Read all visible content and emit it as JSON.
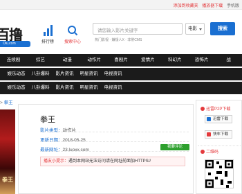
{
  "topbar": {
    "bookmark": "添加到收藏夹",
    "app": "播放器下载",
    "mobile": "手机版"
  },
  "header": {
    "logo_text": "百撸",
    "logo_sub": "Olu.com",
    "nav": [
      {
        "label": "排行榜",
        "icon": "bar-chart-icon"
      },
      {
        "label": "搜索中心",
        "icon": "search-center-icon"
      }
    ],
    "search": {
      "placeholder": "请您输入影片关键字",
      "select_value": "电影",
      "button": "搜索",
      "hot": "热门影视 · 嫌疑人X · 非常CMS"
    }
  },
  "nav_main": [
    "连续剧",
    "综艺",
    "动漫",
    "动作片",
    "喜剧片",
    "爱情片",
    "科幻片",
    "恐怖片",
    "战"
  ],
  "subnav1": [
    "娱乐动态",
    "八卦爆料",
    "影片资讯",
    "明星资讯",
    "电视资讯"
  ],
  "subnav2": [
    "娱乐动态",
    "八卦爆料",
    "影片资讯",
    "明星资讯",
    "电视资讯"
  ],
  "breadcrumb": {
    "sep": "> ",
    "current": "拳王"
  },
  "movie": {
    "poster_text": "拳王",
    "title": "拳王",
    "type_label": "影片类型：",
    "type_value": "动作片",
    "date_label": "更新日期：",
    "date_value": "2018-05-25",
    "site_label": "最新网址：",
    "site_value": "23.luoxx.com",
    "comment_button": "我要评论",
    "notice_label": "播友小提示：",
    "notice_text": "遇到本网站无法访问请在网址前面加HTTPS//"
  },
  "sidebar": {
    "p2p_title": "迅雷P2P下载",
    "buttons": [
      {
        "label": "迅雷下载",
        "color": "#1a6fd1"
      },
      {
        "label": "快车下载",
        "color": "#e4393c"
      }
    ],
    "qr_title": "二维码"
  },
  "colors": {
    "accent": "#1a6fd1",
    "nav_bg": "#1b1b1b",
    "alert": "#e4393c",
    "comment": "#2da02d"
  }
}
